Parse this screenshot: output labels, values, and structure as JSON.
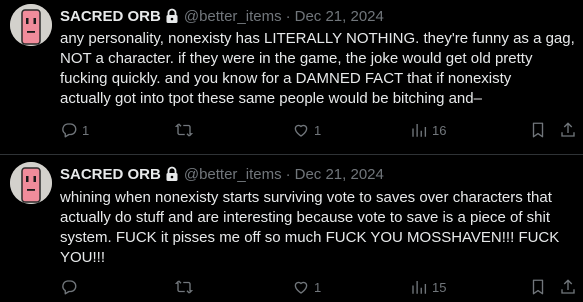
{
  "colors": {
    "background": "#000000",
    "text_primary": "#e7e9ea",
    "text_secondary": "#71767b",
    "divider": "#2f3336"
  },
  "tweets": [
    {
      "avatar_icon": "pink-face-avatar",
      "name": "SACRED ORB",
      "protected_icon": "lock-icon",
      "handle": "@better_items",
      "separator": "·",
      "date": "Dec 21, 2024",
      "text": "any personality, nonexisty has LITERALLY NOTHING. they're funny as a gag,\nNOT a character. if they were in the game, the joke would get old pretty\nfucking quickly. and you know for a DAMNED FACT that if nonexisty\nactually got into tpot these same people would be bitching and–",
      "actions": {
        "replies": "1",
        "retweets": "",
        "likes": "1",
        "views": "16"
      }
    },
    {
      "avatar_icon": "pink-face-avatar",
      "name": "SACRED ORB",
      "protected_icon": "lock-icon",
      "handle": "@better_items",
      "separator": "·",
      "date": "Dec 21, 2024",
      "text": "whining when nonexisty starts surviving vote to saves over characters that\nactually do stuff and are interesting because vote to save is a piece of shit\nsystem. FUCK it pisses me off so much FUCK YOU MOSSHAVEN!!! FUCK\nYOU!!!",
      "actions": {
        "replies": "",
        "retweets": "",
        "likes": "1",
        "views": "15"
      }
    }
  ]
}
